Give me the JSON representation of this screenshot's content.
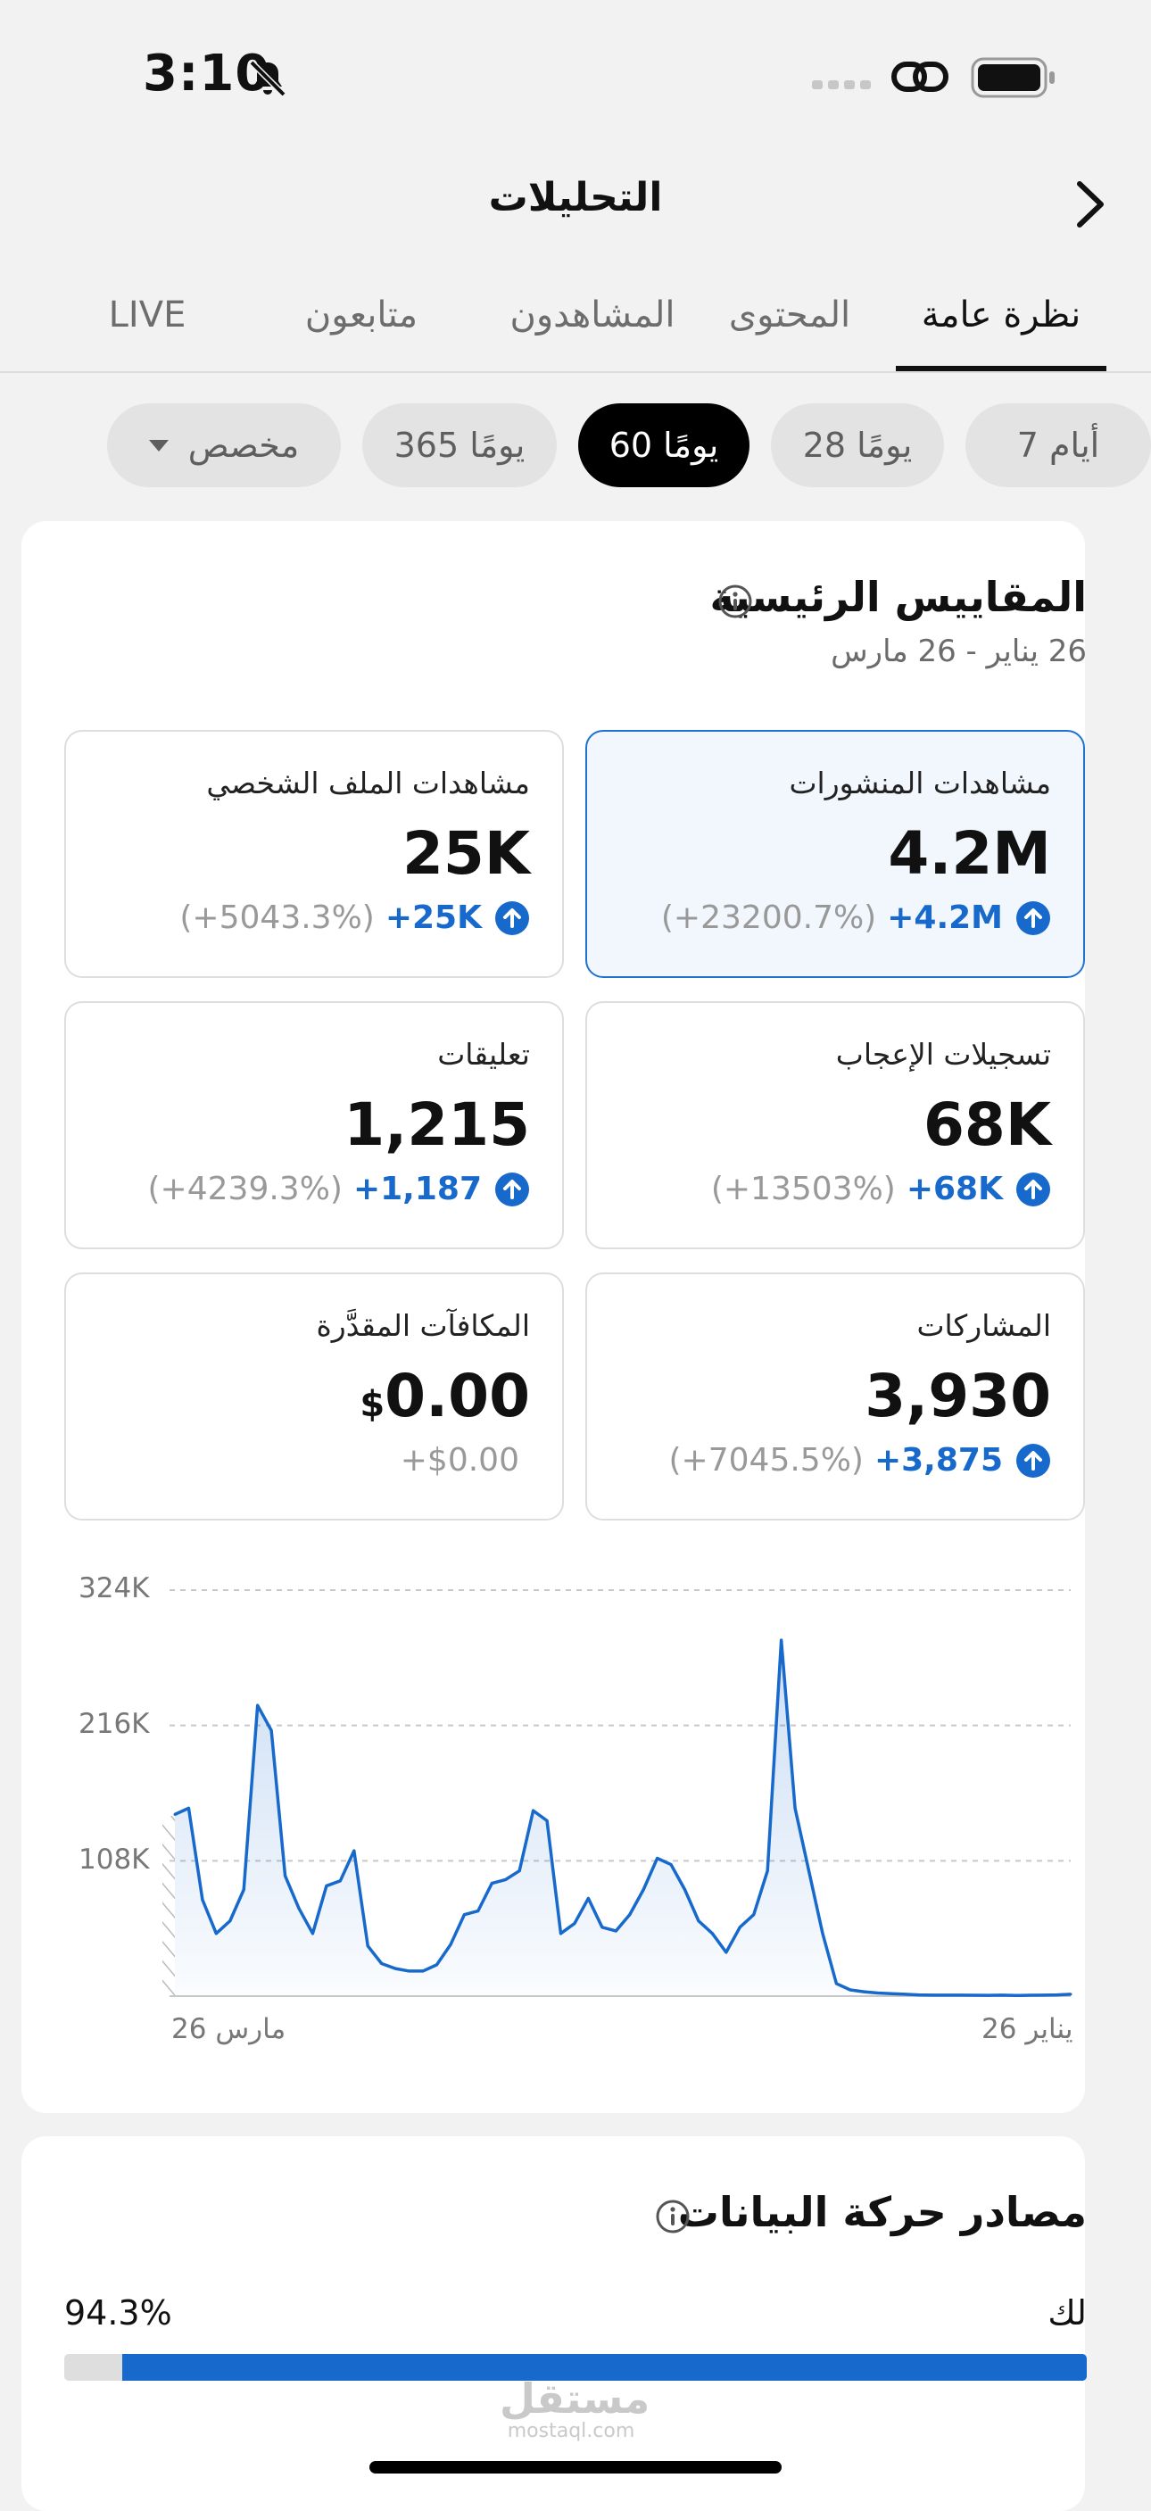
{
  "status_bar": {
    "time": "3:10"
  },
  "header": {
    "title": "التحليلات"
  },
  "tabs": [
    {
      "label": "نظرة عامة",
      "active": true
    },
    {
      "label": "المحتوى",
      "active": false
    },
    {
      "label": "المشاهدون",
      "active": false
    },
    {
      "label": "متابعون",
      "active": false
    },
    {
      "label": "LIVE",
      "active": false
    }
  ],
  "ranges": [
    {
      "label": "7 أيام",
      "active": false
    },
    {
      "label": "28 يومًا",
      "active": false
    },
    {
      "label": "60 يومًا",
      "active": true
    },
    {
      "label": "365 يومًا",
      "active": false
    },
    {
      "label": "مخصص",
      "active": false
    }
  ],
  "key_metrics": {
    "title": "المقاييس الرئيسية",
    "date_range": "26 يناير - 26 مارس",
    "cards": [
      {
        "label": "مشاهدات المنشورات",
        "value": "4.2M",
        "delta": "+4.2M",
        "pct": "(+23200.7%)",
        "selected": true
      },
      {
        "label": "مشاهدات الملف الشخصي",
        "value": "25K",
        "delta": "+25K",
        "pct": "(+5043.3%)"
      },
      {
        "label": "تسجيلات الإعجاب",
        "value": "68K",
        "delta": "+68K",
        "pct": "(+13503%)"
      },
      {
        "label": "تعليقات",
        "value": "1,215",
        "delta": "+1,187",
        "pct": "(+4239.3%)"
      },
      {
        "label": "المشاركات",
        "value": "3,930",
        "delta": "+3,875",
        "pct": "(+7045.5%)"
      },
      {
        "label": "المكافآت المقدَّرة",
        "value": "0.00",
        "currency": "$",
        "delta": "+$0.00"
      }
    ]
  },
  "chart_data": {
    "type": "area",
    "y_ticks": [
      "324K",
      "216K",
      "108K"
    ],
    "ylim": [
      0,
      324000
    ],
    "x_labels": {
      "start": "26 يناير",
      "end": "26 مارس"
    },
    "x_direction": "right-to-left",
    "grid": true,
    "accent_color": "#1769cc",
    "values": [
      1500,
      1000,
      800,
      700,
      500,
      800,
      600,
      700,
      800,
      800,
      800,
      1000,
      1500,
      2000,
      2500,
      3500,
      5000,
      10000,
      50000,
      100000,
      150000,
      284000,
      100000,
      65000,
      55000,
      35000,
      50000,
      60000,
      85000,
      105000,
      110000,
      85000,
      65000,
      52000,
      55000,
      78000,
      58000,
      50000,
      140000,
      148000,
      100000,
      93000,
      90000,
      68000,
      65000,
      41000,
      25000,
      20000,
      20000,
      22000,
      26000,
      40000,
      116000,
      92000,
      88000,
      50000,
      70000,
      96000,
      212000,
      232000,
      85000,
      60000,
      50000,
      77000,
      150000,
      145000
    ]
  },
  "traffic": {
    "title": "مصادر حركة البيانات",
    "label": "لك",
    "percent_text": "94.3%",
    "percent": 0.943
  },
  "watermark": {
    "text": "مستقل",
    "sub": "mostaql.com"
  }
}
